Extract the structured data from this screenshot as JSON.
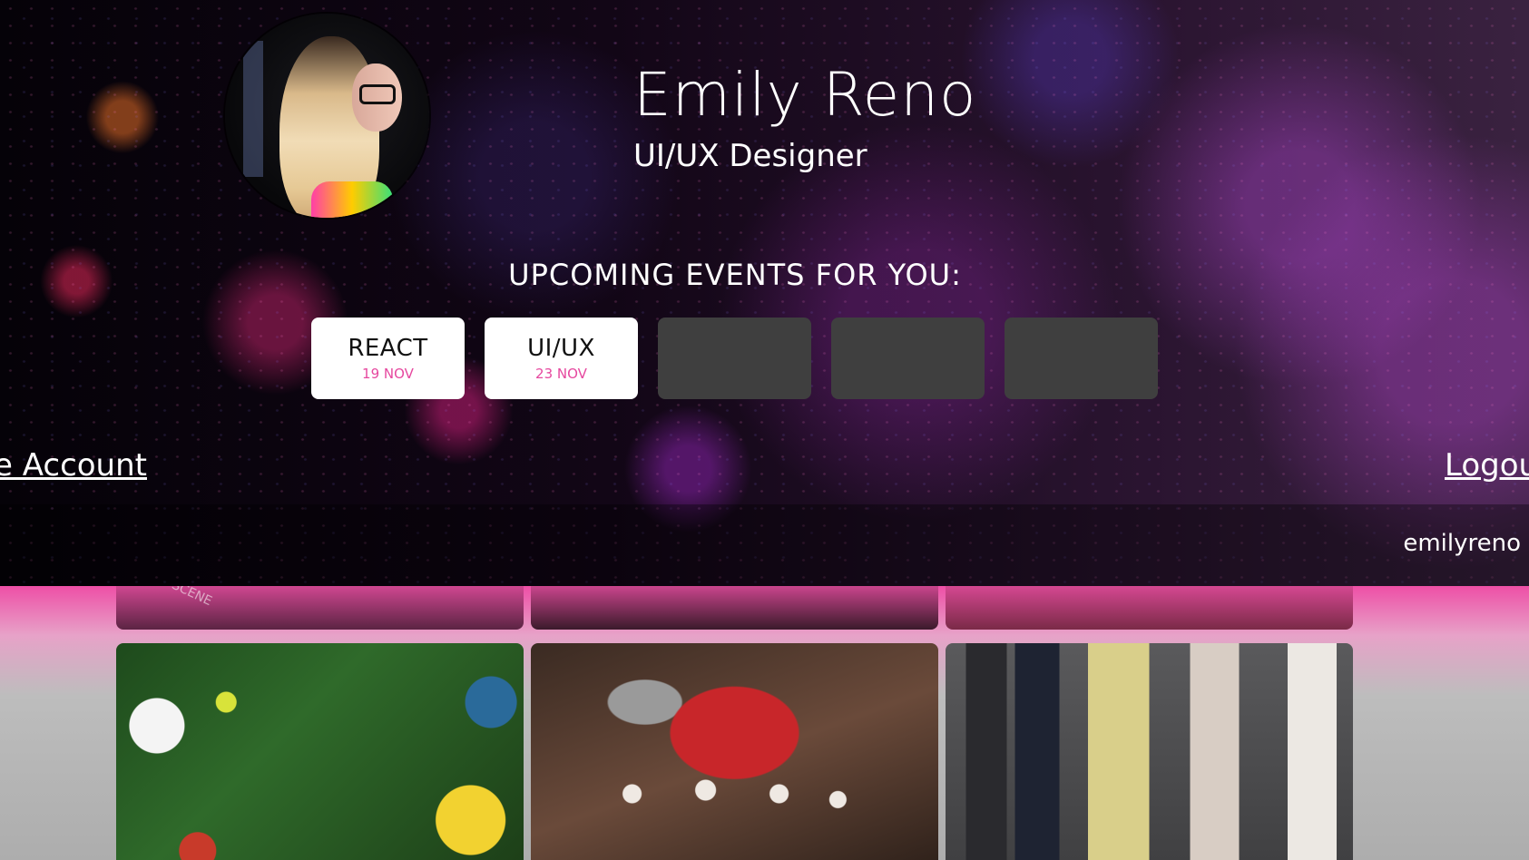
{
  "profile": {
    "name": "Emily Reno",
    "role": "UI/UX Designer",
    "username": "emilyreno"
  },
  "events": {
    "heading": "UPCOMING EVENTS FOR YOU:",
    "items": [
      {
        "title": "REACT",
        "date": "19 NOV"
      },
      {
        "title": "UI/UX",
        "date": "23 NOV"
      },
      {
        "title": "",
        "date": ""
      },
      {
        "title": "",
        "date": ""
      },
      {
        "title": "",
        "date": ""
      }
    ]
  },
  "links": {
    "account": "e Account",
    "logout": "Logou"
  },
  "tiles": {
    "scene_text": "SCENE"
  },
  "colors": {
    "accent": "#e6489f",
    "event_bg_empty": "#3f3f3f",
    "event_bg_filled": "#ffffff"
  }
}
